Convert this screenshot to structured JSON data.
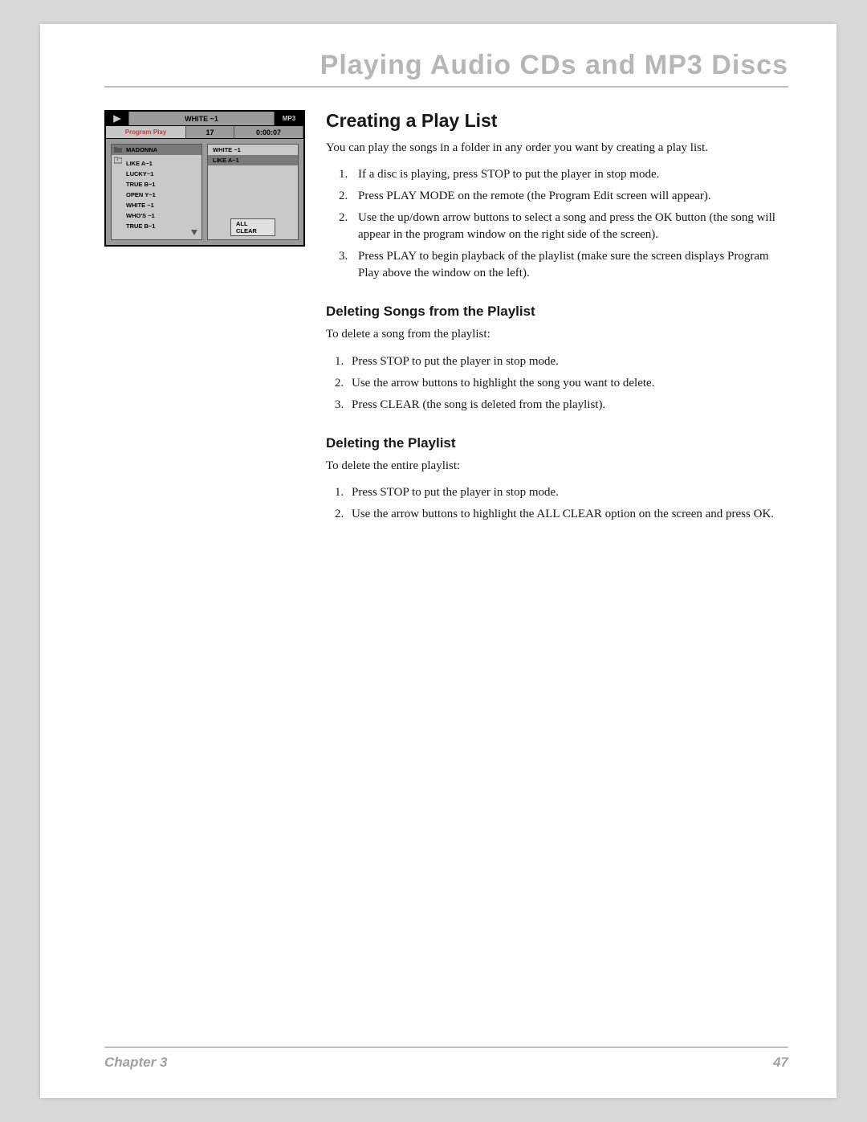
{
  "page_title": "Playing Audio CDs and MP3 Discs",
  "footer": {
    "chapter": "Chapter 3",
    "page": "47"
  },
  "snapshot": {
    "topbar": {
      "track_title": "WHITE ~1",
      "badge": "MP3"
    },
    "status": {
      "mode": "Program Play",
      "track_no": "17",
      "time": "0:00:07"
    },
    "left_pane": {
      "rows": [
        {
          "icon": "folder",
          "label": "MADONNA",
          "highlight": true
        },
        {
          "icon": "return",
          "label": "",
          "highlight": false
        },
        {
          "icon": "",
          "label": "LIKE A~1",
          "highlight": false
        },
        {
          "icon": "",
          "label": "LUCKY~1",
          "highlight": false
        },
        {
          "icon": "",
          "label": "TRUE B~1",
          "highlight": false
        },
        {
          "icon": "",
          "label": "OPEN Y~1",
          "highlight": false
        },
        {
          "icon": "",
          "label": "WHITE ~1",
          "highlight": false
        },
        {
          "icon": "",
          "label": "WHO'S ~1",
          "highlight": false
        },
        {
          "icon": "",
          "label": "TRUE B~1",
          "highlight": false
        }
      ],
      "scroll_hint": "down"
    },
    "right_pane": {
      "rows": [
        {
          "label": "WHITE ~1",
          "highlight": false
        },
        {
          "label": "LIKE A~1",
          "highlight": true
        }
      ],
      "all_clear": "ALL CLEAR"
    }
  },
  "sections": {
    "h1": "Creating a Play List",
    "intro": "You can play the songs in a folder in any order you want by creating a play list.",
    "steps1": [
      "If a disc is playing, press STOP to put the player in stop mode.",
      "Press PLAY MODE on the remote (the Program Edit screen will appear).",
      "Use the up/down arrow buttons to select a song and press the OK button (the song will appear in the program window on the right side of the screen).",
      "Press PLAY to begin playback of the playlist (make sure the screen displays Program Play above the window on the left)."
    ],
    "steps1_numbers": [
      "1.",
      "2.",
      "2.",
      "3."
    ],
    "h2a": "Deleting Songs from the Playlist",
    "p2a": "To delete a song from the playlist:",
    "steps2": [
      "Press STOP to put the player in stop mode.",
      "Use the arrow buttons to highlight the song you want to delete.",
      "Press CLEAR (the song is deleted from the playlist)."
    ],
    "h2b": "Deleting the Playlist",
    "p2b": "To delete the entire playlist:",
    "steps3": [
      "Press STOP to put the player in stop mode.",
      "Use the arrow buttons to highlight the ALL CLEAR option on the screen and press OK."
    ]
  }
}
